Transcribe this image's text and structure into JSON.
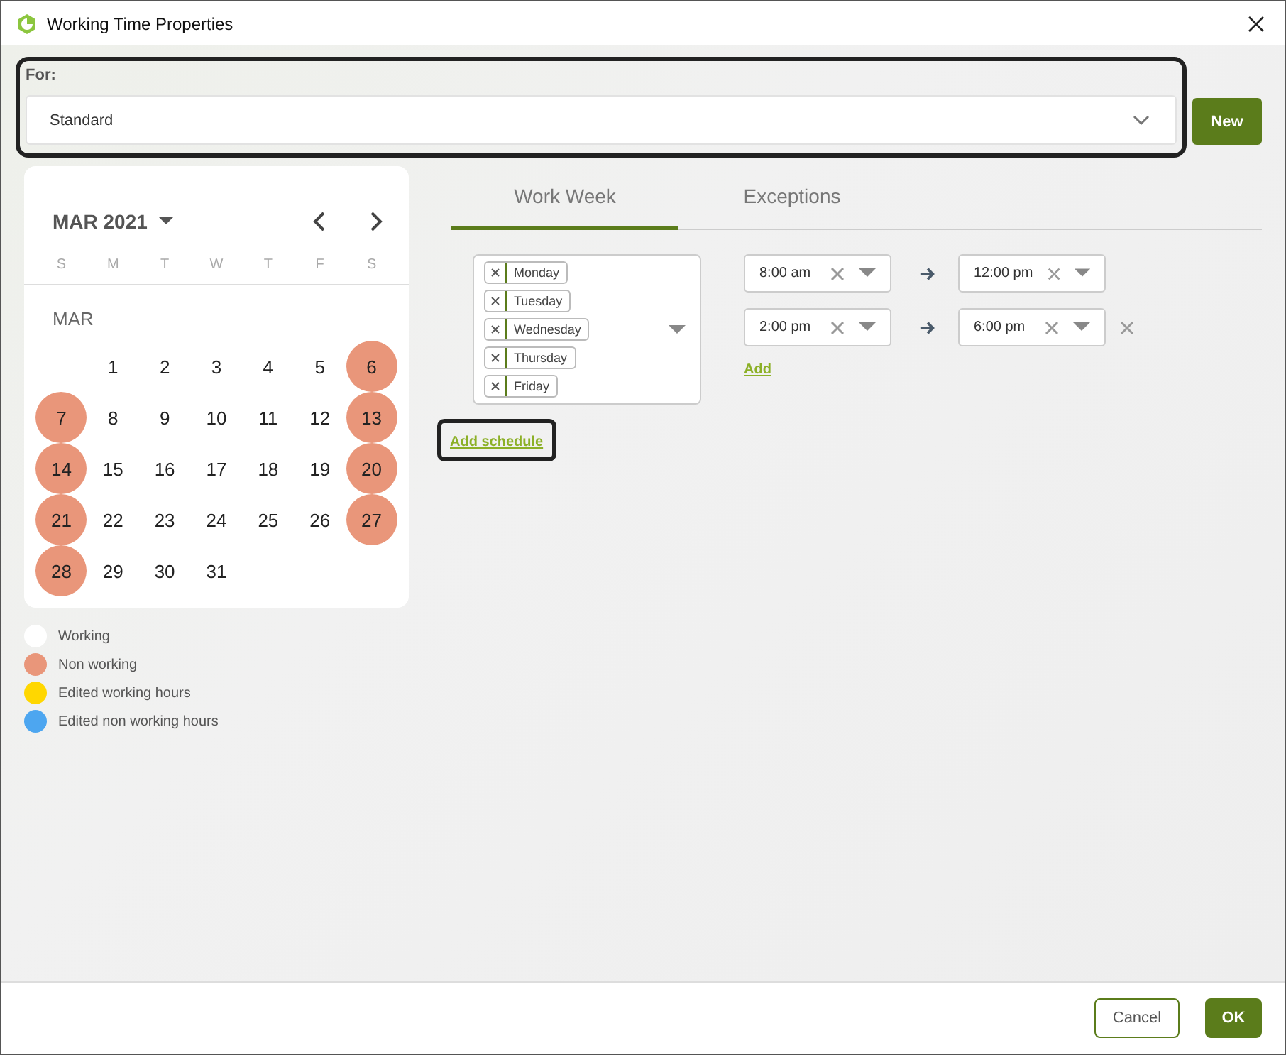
{
  "window": {
    "title": "Working Time Properties"
  },
  "for_field": {
    "label": "For:",
    "value": "Standard",
    "new_button": "New"
  },
  "calendar": {
    "month_year": "MAR 2021",
    "month_label": "MAR",
    "weekdays": [
      "S",
      "M",
      "T",
      "W",
      "T",
      "F",
      "S"
    ],
    "weeks": [
      [
        {
          "day": "1",
          "non_working": false
        },
        {
          "day": "2",
          "non_working": false
        },
        {
          "day": "3",
          "non_working": false
        },
        {
          "day": "4",
          "non_working": false
        },
        {
          "day": "5",
          "non_working": false
        },
        {
          "day": "6",
          "non_working": true
        }
      ],
      [
        {
          "day": "7",
          "non_working": true
        },
        {
          "day": "8",
          "non_working": false
        },
        {
          "day": "9",
          "non_working": false
        },
        {
          "day": "10",
          "non_working": false
        },
        {
          "day": "11",
          "non_working": false
        },
        {
          "day": "12",
          "non_working": false
        },
        {
          "day": "13",
          "non_working": true
        }
      ],
      [
        {
          "day": "14",
          "non_working": true
        },
        {
          "day": "15",
          "non_working": false
        },
        {
          "day": "16",
          "non_working": false
        },
        {
          "day": "17",
          "non_working": false
        },
        {
          "day": "18",
          "non_working": false
        },
        {
          "day": "19",
          "non_working": false
        },
        {
          "day": "20",
          "non_working": true
        }
      ],
      [
        {
          "day": "21",
          "non_working": true
        },
        {
          "day": "22",
          "non_working": false
        },
        {
          "day": "23",
          "non_working": false
        },
        {
          "day": "24",
          "non_working": false
        },
        {
          "day": "25",
          "non_working": false
        },
        {
          "day": "26",
          "non_working": false
        },
        {
          "day": "27",
          "non_working": true
        }
      ],
      [
        {
          "day": "28",
          "non_working": true
        },
        {
          "day": "29",
          "non_working": false
        },
        {
          "day": "30",
          "non_working": false
        },
        {
          "day": "31",
          "non_working": false
        }
      ]
    ]
  },
  "legend": [
    {
      "label": "Working",
      "color": "#ffffff"
    },
    {
      "label": "Non working",
      "color": "#e9967a"
    },
    {
      "label": "Edited working hours",
      "color": "#ffd700"
    },
    {
      "label": "Edited non working hours",
      "color": "#4da6f0"
    }
  ],
  "tabs": [
    {
      "label": "Work Week",
      "selected": true
    },
    {
      "label": "Exceptions",
      "selected": false
    }
  ],
  "schedule": {
    "days": [
      "Monday",
      "Tuesday",
      "Wednesday",
      "Thursday",
      "Friday"
    ],
    "ranges": [
      {
        "start": "8:00 am",
        "end": "12:00 pm",
        "removable": false
      },
      {
        "start": "2:00 pm",
        "end": "6:00 pm",
        "removable": true
      }
    ],
    "add_link": "Add",
    "add_schedule_link": "Add schedule"
  },
  "buttons": {
    "cancel": "Cancel",
    "ok": "OK"
  }
}
